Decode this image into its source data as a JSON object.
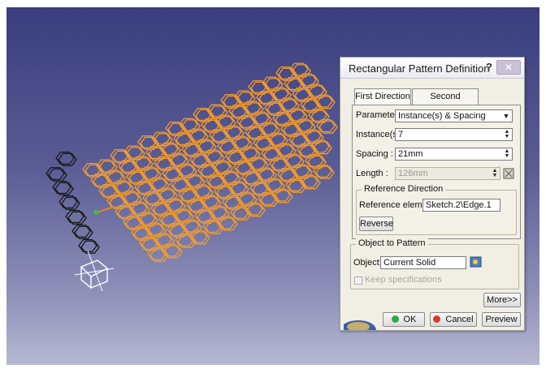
{
  "dialog": {
    "title": "Rectangular Pattern Definition",
    "help_label": "?",
    "close_label": "✕",
    "tabs": [
      {
        "label": "First Direction",
        "active": true
      },
      {
        "label": "Second Direction",
        "active": false
      }
    ],
    "parameters": {
      "label": "Parameters:",
      "value": "Instance(s) & Spacing"
    },
    "instances": {
      "label": "Instance(s) :",
      "value": "7"
    },
    "spacing": {
      "label": "Spacing :",
      "value": "21mm"
    },
    "length": {
      "label": "Length :",
      "value": "126mm"
    },
    "reference_direction": {
      "title": "Reference Direction",
      "element_label": "Reference element:",
      "element_value": "Sketch.2\\Edge.1",
      "reverse_label": "Reverse"
    },
    "object_to_pattern": {
      "title": "Object to Pattern",
      "object_label": "Object:",
      "object_value": "Current Solid",
      "keep_spec_label": "Keep specifications",
      "keep_spec_checked": false
    },
    "more_label": "More>>",
    "ok_label": "OK",
    "cancel_label": "Cancel",
    "preview_label": "Preview"
  },
  "colors": {
    "pattern_orange": "#f39a2c",
    "original_black": "#1a1a1a",
    "ok_green": "#2fa84a",
    "cancel_red": "#d33a2a"
  }
}
